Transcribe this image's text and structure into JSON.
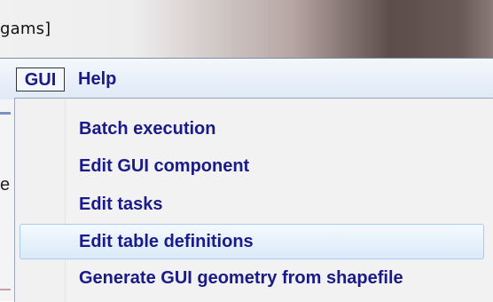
{
  "window": {
    "title_fragment": "gams]"
  },
  "menubar": {
    "items": [
      {
        "label": "GUI"
      },
      {
        "label": "Help"
      }
    ]
  },
  "left_panel": {
    "char": "e"
  },
  "dropdown": {
    "items": [
      {
        "label": "Batch execution"
      },
      {
        "label": "Edit GUI component"
      },
      {
        "label": "Edit tasks"
      },
      {
        "label": "Edit table definitions",
        "highlighted": true
      },
      {
        "label": "Generate GUI geometry from shapefile"
      }
    ]
  },
  "colors": {
    "menu_text": "#1a1a88",
    "highlight_border": "#a8cdee",
    "highlight_fill": "#dbeaf9"
  }
}
